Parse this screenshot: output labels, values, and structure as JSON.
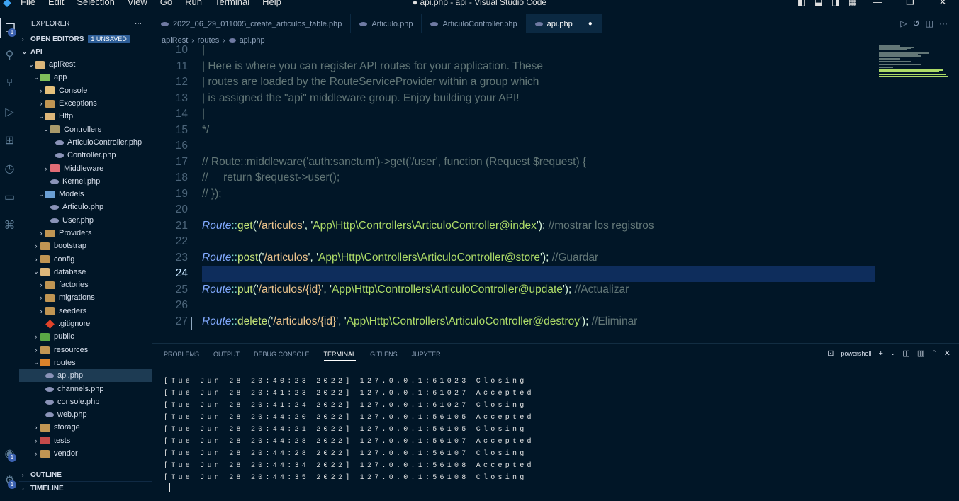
{
  "window": {
    "title": "● api.php - api - Visual Studio Code",
    "menu": [
      "File",
      "Edit",
      "Selection",
      "View",
      "Go",
      "Run",
      "Terminal",
      "Help"
    ],
    "controls": [
      "layout-sidebar-left-icon",
      "layout-panel-icon",
      "layout-sidebar-right-icon",
      "layout-custom-icon",
      "minimize-icon",
      "restore-icon",
      "close-icon"
    ]
  },
  "activity_bar": {
    "explorer_badge": "1",
    "accounts_badge": "1",
    "settings_badge": "1"
  },
  "sidebar": {
    "title": "EXPLORER",
    "more": "···",
    "open_editors": "OPEN EDITORS",
    "unsaved_badge": "1 UNSAVED",
    "root": "API",
    "tree": [
      {
        "label": "apiRest",
        "indent": 1,
        "chev": "⌄",
        "icon": "folder-open"
      },
      {
        "label": "app",
        "indent": 2,
        "chev": "⌄",
        "icon": "folder-app"
      },
      {
        "label": "Console",
        "indent": 3,
        "chev": "›",
        "icon": "folder-console"
      },
      {
        "label": "Exceptions",
        "indent": 3,
        "chev": "›",
        "icon": "folder"
      },
      {
        "label": "Http",
        "indent": 3,
        "chev": "⌄",
        "icon": "folder-open"
      },
      {
        "label": "Controllers",
        "indent": 4,
        "chev": "⌄",
        "icon": "folder-controllers"
      },
      {
        "label": "ArticuloController.php",
        "indent": 5,
        "chev": "",
        "icon": "php"
      },
      {
        "label": "Controller.php",
        "indent": 5,
        "chev": "",
        "icon": "php"
      },
      {
        "label": "Middleware",
        "indent": 4,
        "chev": "›",
        "icon": "folder-middleware"
      },
      {
        "label": "Kernel.php",
        "indent": 4,
        "chev": "",
        "icon": "php"
      },
      {
        "label": "Models",
        "indent": 3,
        "chev": "⌄",
        "icon": "folder-models"
      },
      {
        "label": "Articulo.php",
        "indent": 4,
        "chev": "",
        "icon": "php"
      },
      {
        "label": "User.php",
        "indent": 4,
        "chev": "",
        "icon": "php"
      },
      {
        "label": "Providers",
        "indent": 3,
        "chev": "›",
        "icon": "folder"
      },
      {
        "label": "bootstrap",
        "indent": 2,
        "chev": "›",
        "icon": "folder"
      },
      {
        "label": "config",
        "indent": 2,
        "chev": "›",
        "icon": "folder"
      },
      {
        "label": "database",
        "indent": 2,
        "chev": "⌄",
        "icon": "folder-open"
      },
      {
        "label": "factories",
        "indent": 3,
        "chev": "›",
        "icon": "folder"
      },
      {
        "label": "migrations",
        "indent": 3,
        "chev": "›",
        "icon": "folder"
      },
      {
        "label": "seeders",
        "indent": 3,
        "chev": "›",
        "icon": "folder"
      },
      {
        "label": ".gitignore",
        "indent": 3,
        "chev": "",
        "icon": "git"
      },
      {
        "label": "public",
        "indent": 2,
        "chev": "›",
        "icon": "folder-public"
      },
      {
        "label": "resources",
        "indent": 2,
        "chev": "›",
        "icon": "folder"
      },
      {
        "label": "routes",
        "indent": 2,
        "chev": "⌄",
        "icon": "folder-routes"
      },
      {
        "label": "api.php",
        "indent": 3,
        "chev": "",
        "icon": "php",
        "selected": true
      },
      {
        "label": "channels.php",
        "indent": 3,
        "chev": "",
        "icon": "php"
      },
      {
        "label": "console.php",
        "indent": 3,
        "chev": "",
        "icon": "php"
      },
      {
        "label": "web.php",
        "indent": 3,
        "chev": "",
        "icon": "php"
      },
      {
        "label": "storage",
        "indent": 2,
        "chev": "›",
        "icon": "folder"
      },
      {
        "label": "tests",
        "indent": 2,
        "chev": "›",
        "icon": "folder-tests"
      },
      {
        "label": "vendor",
        "indent": 2,
        "chev": "›",
        "icon": "folder"
      }
    ],
    "outline": "OUTLINE",
    "timeline": "TIMELINE"
  },
  "tabs": [
    {
      "label": "2022_06_29_011005_create_articulos_table.php",
      "active": false
    },
    {
      "label": "Articulo.php",
      "active": false
    },
    {
      "label": "ArticuloController.php",
      "active": false
    },
    {
      "label": "api.php",
      "active": true,
      "dirty": "●"
    }
  ],
  "breadcrumb": [
    "apiRest",
    "routes",
    "api.php"
  ],
  "editor": {
    "current_line": 24,
    "lines": [
      {
        "n": "10",
        "tokens": [
          [
            "c-comment",
            "|"
          ]
        ]
      },
      {
        "n": "11",
        "tokens": [
          [
            "c-comment",
            "| Here is where you can register API routes for your application. These"
          ]
        ]
      },
      {
        "n": "12",
        "tokens": [
          [
            "c-comment",
            "| routes are loaded by the RouteServiceProvider within a group which"
          ]
        ]
      },
      {
        "n": "13",
        "tokens": [
          [
            "c-comment",
            "| is assigned the \"api\" middleware group. Enjoy building your API!"
          ]
        ]
      },
      {
        "n": "14",
        "tokens": [
          [
            "c-comment",
            "|"
          ]
        ]
      },
      {
        "n": "15",
        "tokens": [
          [
            "c-comment",
            "*/"
          ]
        ]
      },
      {
        "n": "16",
        "tokens": []
      },
      {
        "n": "17",
        "tokens": [
          [
            "c-comment",
            "// Route::middleware('auth:sanctum')->get('/user', function (Request $request) {"
          ]
        ]
      },
      {
        "n": "18",
        "tokens": [
          [
            "c-comment",
            "//     return $request->user();"
          ]
        ]
      },
      {
        "n": "19",
        "tokens": [
          [
            "c-comment",
            "// });"
          ]
        ]
      },
      {
        "n": "20",
        "tokens": []
      },
      {
        "n": "21",
        "tokens": [
          [
            "c-class",
            "Route"
          ],
          [
            "c-op",
            "::"
          ],
          [
            "c-fn",
            "get"
          ],
          [
            "c-punc",
            "("
          ],
          [
            "c-strq",
            "'"
          ],
          [
            "c-str",
            "/articulos"
          ],
          [
            "c-strq",
            "'"
          ],
          [
            "c-punc",
            ", "
          ],
          [
            "c-strq",
            "'"
          ],
          [
            "c-green",
            "App\\Http\\Controllers\\ArticuloController@index"
          ],
          [
            "c-strq",
            "'"
          ],
          [
            "c-punc",
            "); "
          ],
          [
            "c-comment",
            "//mostrar los registros"
          ]
        ]
      },
      {
        "n": "22",
        "tokens": []
      },
      {
        "n": "23",
        "tokens": [
          [
            "c-class",
            "Route"
          ],
          [
            "c-op",
            "::"
          ],
          [
            "c-fn",
            "post"
          ],
          [
            "c-punc",
            "("
          ],
          [
            "c-strq",
            "'"
          ],
          [
            "c-str",
            "/articulos"
          ],
          [
            "c-strq",
            "'"
          ],
          [
            "c-punc",
            ", "
          ],
          [
            "c-strq",
            "'"
          ],
          [
            "c-green",
            "App\\Http\\Controllers\\ArticuloController@store"
          ],
          [
            "c-strq",
            "'"
          ],
          [
            "c-punc",
            "); "
          ],
          [
            "c-comment",
            "//Guardar"
          ]
        ]
      },
      {
        "n": "24",
        "tokens": []
      },
      {
        "n": "25",
        "tokens": [
          [
            "c-class",
            "Route"
          ],
          [
            "c-op",
            "::"
          ],
          [
            "c-fn",
            "put"
          ],
          [
            "c-punc",
            "("
          ],
          [
            "c-strq",
            "'"
          ],
          [
            "c-str",
            "/articulos/{id}"
          ],
          [
            "c-strq",
            "'"
          ],
          [
            "c-punc",
            ", "
          ],
          [
            "c-strq",
            "'"
          ],
          [
            "c-green",
            "App\\Http\\Controllers\\ArticuloController@update"
          ],
          [
            "c-strq",
            "'"
          ],
          [
            "c-punc",
            "); "
          ],
          [
            "c-comment",
            "//Actualizar"
          ]
        ]
      },
      {
        "n": "26",
        "tokens": []
      },
      {
        "n": "27",
        "tokens": [
          [
            "c-class",
            "Route"
          ],
          [
            "c-op",
            "::"
          ],
          [
            "c-fn",
            "delete"
          ],
          [
            "c-punc",
            "("
          ],
          [
            "c-strq",
            "'"
          ],
          [
            "c-str",
            "/articulos/{id}"
          ],
          [
            "c-strq",
            "'"
          ],
          [
            "c-punc",
            ", "
          ],
          [
            "c-strq",
            "'"
          ],
          [
            "c-green",
            "App\\Http\\Controllers\\ArticuloController@destroy"
          ],
          [
            "c-strq",
            "'"
          ],
          [
            "c-punc",
            "); "
          ],
          [
            "c-comment",
            "//Eliminar"
          ]
        ]
      }
    ]
  },
  "panel": {
    "tabs": [
      "PROBLEMS",
      "OUTPUT",
      "DEBUG CONSOLE",
      "TERMINAL",
      "GITLENS",
      "JUPYTER"
    ],
    "active_tab": "TERMINAL",
    "shell": "powershell",
    "terminal_lines": [
      "[Tue Jun 28 20:40:23 2022] 127.0.0.1:61023 Closing",
      "[Tue Jun 28 20:41:23 2022] 127.0.0.1:61027 Accepted",
      "[Tue Jun 28 20:41:24 2022] 127.0.0.1:61027 Closing",
      "[Tue Jun 28 20:44:20 2022] 127.0.0.1:56105 Accepted",
      "[Tue Jun 28 20:44:21 2022] 127.0.0.1:56105 Closing",
      "[Tue Jun 28 20:44:28 2022] 127.0.0.1:56107 Accepted",
      "[Tue Jun 28 20:44:28 2022] 127.0.0.1:56107 Closing",
      "[Tue Jun 28 20:44:34 2022] 127.0.0.1:56108 Accepted",
      "[Tue Jun 28 20:44:35 2022] 127.0.0.1:56108 Closing"
    ]
  },
  "colors": {
    "background": "#011627",
    "accent": "#3b61b0",
    "current_line": "#0e2d5c"
  }
}
